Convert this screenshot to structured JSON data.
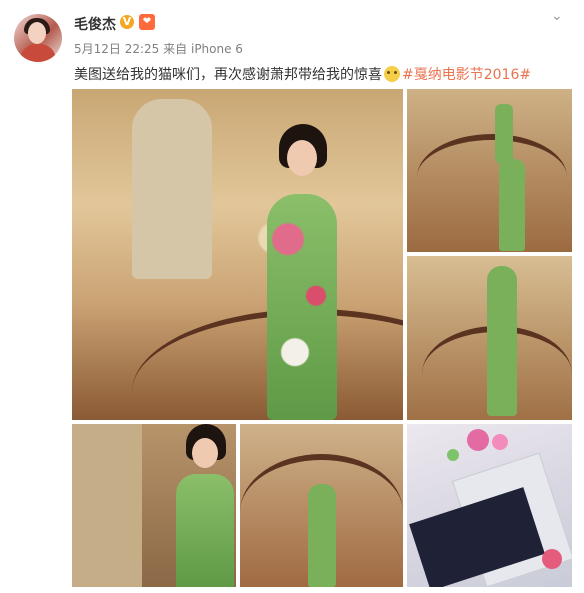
{
  "post": {
    "author": "毛俊杰",
    "date": "5月12日 22:25",
    "source_prefix": "来自",
    "device": "iPhone 6",
    "text_main": "美图送给我的猫咪们，再次感谢萧邦带给我的惊喜",
    "topic": "#戛纳电影节2016#",
    "badges": {
      "verified": "V",
      "fan": "❤"
    },
    "more_icon": "chevron-down-icon"
  },
  "photos": [
    {
      "name": "photo-1-main"
    },
    {
      "name": "photo-2"
    },
    {
      "name": "photo-3"
    },
    {
      "name": "photo-4"
    },
    {
      "name": "photo-5"
    },
    {
      "name": "photo-6-invitation"
    }
  ],
  "colors": {
    "topic": "#eb7350",
    "verified": "#f5a623",
    "text": "#333333",
    "meta": "#808080"
  }
}
